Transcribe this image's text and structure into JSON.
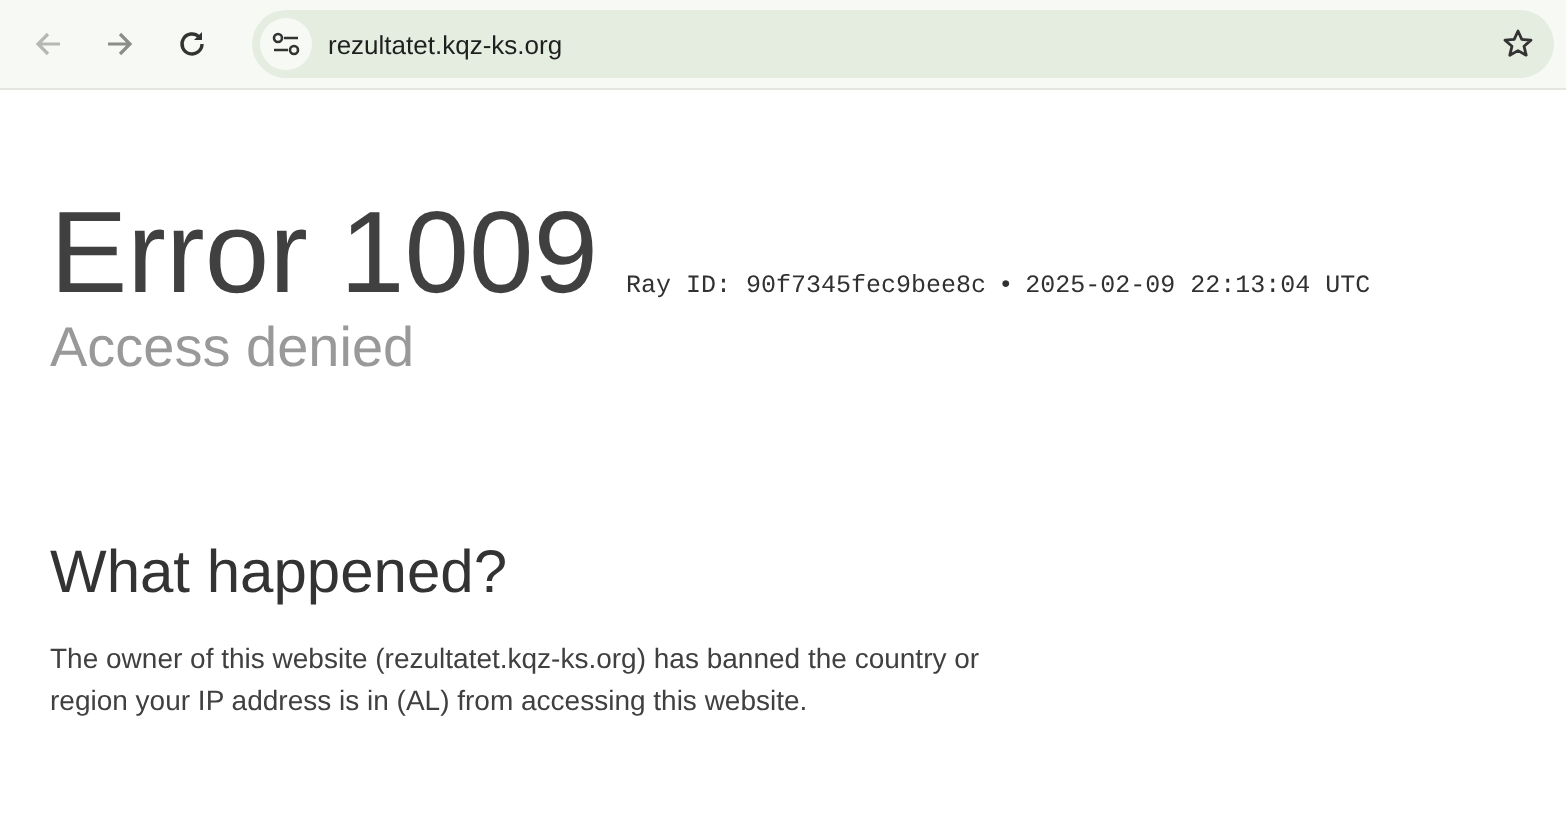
{
  "browser": {
    "back_disabled": true,
    "forward_disabled": false,
    "url": "rezultatet.kqz-ks.org"
  },
  "error": {
    "title": "Error 1009",
    "ray_id": "Ray ID: 90f7345fec9bee8c",
    "separator": "•",
    "timestamp": "2025-02-09 22:13:04 UTC",
    "subtitle": "Access denied"
  },
  "section": {
    "heading": "What happened?",
    "text": "The owner of this website (rezultatet.kqz-ks.org) has banned the country or region your IP address is in (AL) from accessing this website."
  }
}
